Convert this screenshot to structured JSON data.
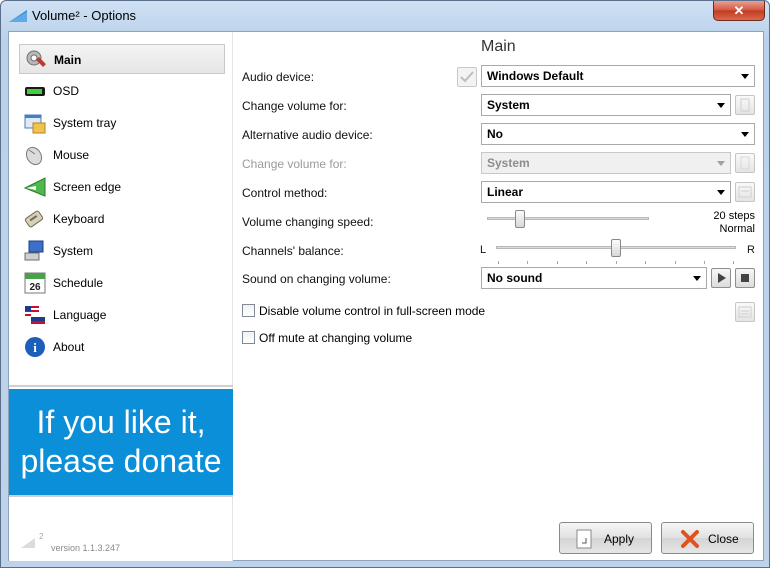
{
  "window": {
    "title": "Volume² - Options",
    "close_glyph": "✕"
  },
  "sidebar": {
    "items": [
      {
        "label": "Main",
        "icon": "gear-icon",
        "selected": true
      },
      {
        "label": "OSD",
        "icon": "osd-bar-icon"
      },
      {
        "label": "System tray",
        "icon": "system-tray-icon"
      },
      {
        "label": "Mouse",
        "icon": "mouse-icon"
      },
      {
        "label": "Screen edge",
        "icon": "screen-edge-icon"
      },
      {
        "label": "Keyboard",
        "icon": "keyboard-icon"
      },
      {
        "label": "System",
        "icon": "system-computer-icon"
      },
      {
        "label": "Schedule",
        "icon": "calendar-icon",
        "icon_text": "26"
      },
      {
        "label": "Language",
        "icon": "flags-icon"
      },
      {
        "label": "About",
        "icon": "info-icon",
        "icon_text": "i"
      }
    ],
    "donate_line1": "If you like it,",
    "donate_line2": "please donate",
    "version_icon_text": "2",
    "version": "version 1.1.3.247"
  },
  "main": {
    "title": "Main",
    "audio_device": {
      "label": "Audio device:",
      "value": "Windows Default"
    },
    "change_volume_for": {
      "label": "Change volume for:",
      "value": "System"
    },
    "alt_audio_device": {
      "label": "Alternative audio device:",
      "value": "No"
    },
    "alt_change_volume_for": {
      "label": "Change volume for:",
      "value": "System",
      "disabled": true
    },
    "control_method": {
      "label": "Control method:",
      "value": "Linear"
    },
    "volume_speed": {
      "label": "Volume changing speed:",
      "value_line1": "20 steps",
      "value_line2": "Normal",
      "position": 0.2
    },
    "balance": {
      "label": "Channels' balance:",
      "left": "L",
      "right": "R",
      "position": 0.5
    },
    "sound_on_change": {
      "label": "Sound on changing volume:",
      "value": "No sound"
    },
    "disable_fullscreen": {
      "label": "Disable volume control in full-screen mode",
      "checked": false
    },
    "off_mute": {
      "label": "Off mute at changing volume",
      "checked": false
    }
  },
  "buttons": {
    "apply": "Apply",
    "close": "Close"
  },
  "colors": {
    "donate_bg": "#0a8fd8",
    "title_bar": "#bed3ea",
    "close_button": "#c23a22"
  }
}
